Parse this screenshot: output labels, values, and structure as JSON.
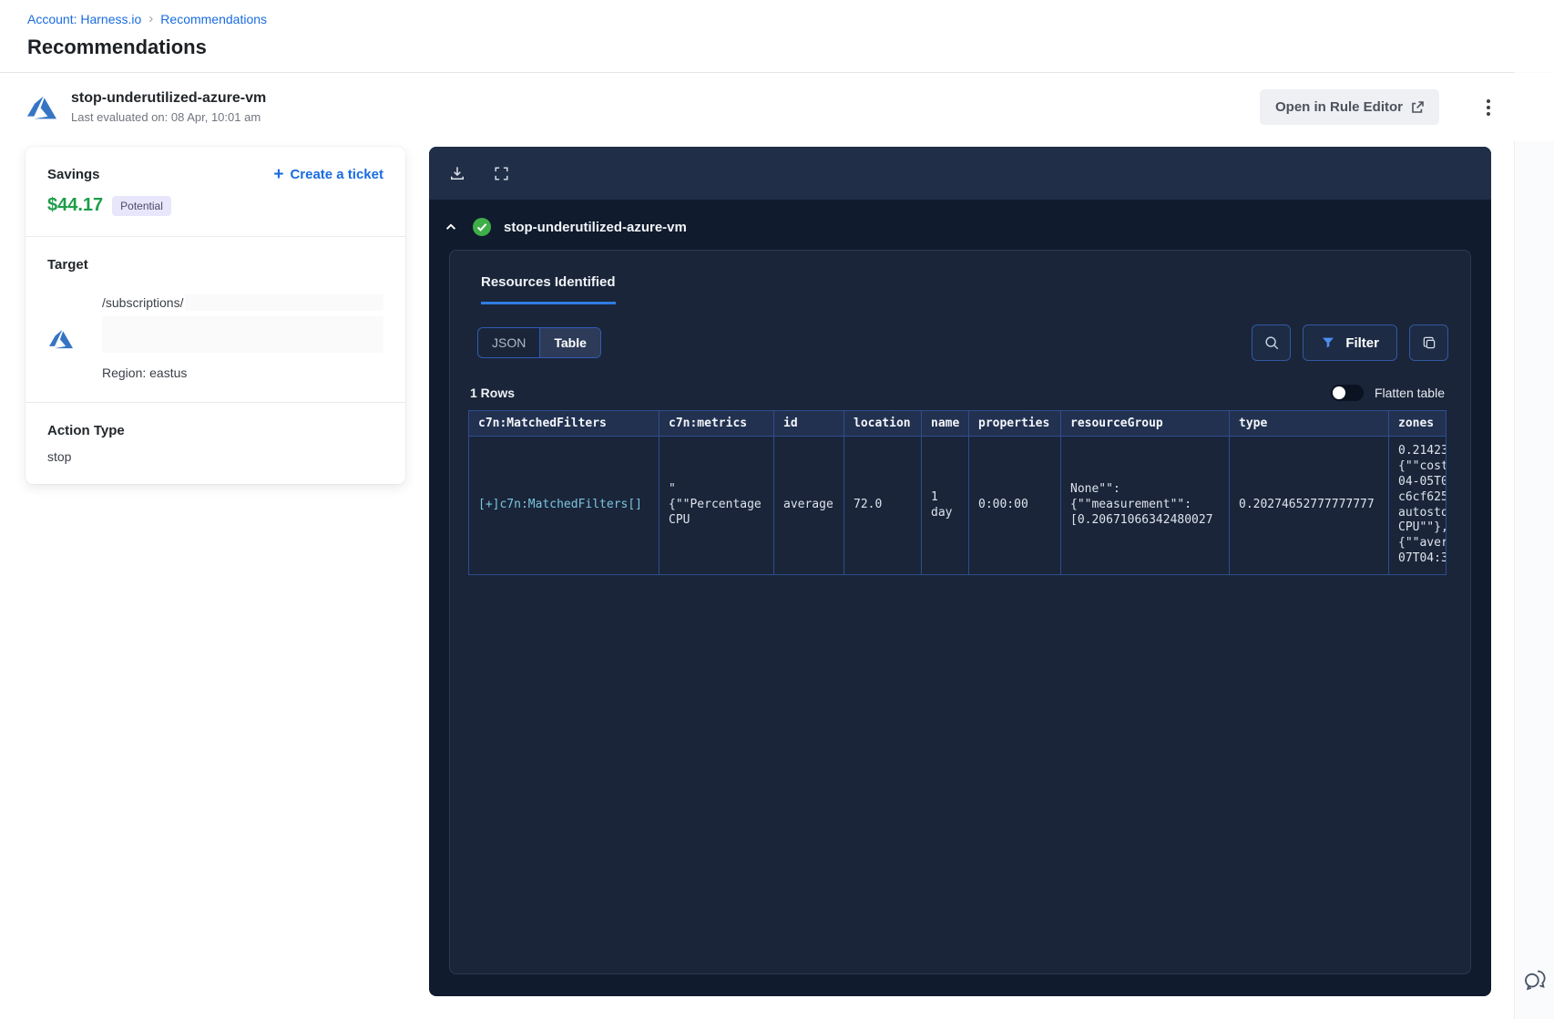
{
  "breadcrumb": {
    "account": "Account: Harness.io",
    "separator": "›",
    "current": "Recommendations"
  },
  "page_title": "Recommendations",
  "recommendation_header": {
    "name": "stop-underutilized-azure-vm",
    "last_evaluated": "Last evaluated on: 08 Apr, 10:01 am",
    "open_rule_editor_label": "Open in Rule Editor"
  },
  "savings_card": {
    "savings_label": "Savings",
    "create_ticket_label": "Create a ticket",
    "plus_glyph": "+",
    "amount": "$44.17",
    "badge": "Potential",
    "target_label": "Target",
    "target_path": "/subscriptions/",
    "region": "Region: eastus",
    "action_type_label": "Action Type",
    "action_type_value": "stop"
  },
  "panel": {
    "title": "stop-underutilized-azure-vm",
    "tab_label": "Resources Identified",
    "view_toggle": {
      "json_label": "JSON",
      "table_label": "Table",
      "selected": "Table"
    },
    "filter_label": "Filter",
    "rows_count": "1 Rows",
    "flatten_label": "Flatten table",
    "flatten_enabled": false,
    "table": {
      "columns": [
        "c7n:MatchedFilters",
        "c7n:metrics",
        "id",
        "location",
        "name",
        "properties",
        "resourceGroup",
        "type",
        "zones"
      ],
      "rows": [
        {
          "cells": [
            "[+]c7n:MatchedFilters[]",
            "\"\n{\"\"Percentage\nCPU",
            "average",
            "72.0",
            "1\nday",
            "0:00:00",
            "None\"\":\n{\"\"measurement\"\":\n[0.20671066342480027",
            "0.20274652777777777",
            "0.21423\n{\"\"cost\n04-05T0\nc6cf625\nautosto\nCPU\"\"},\n{\"\"aver\n07T04:3"
          ]
        }
      ]
    }
  },
  "colors": {
    "accent_blue": "#1a6ce0",
    "savings_green": "#1e9e4a",
    "badge_bg": "#e8e6fb",
    "panel_bg": "#101b2d",
    "toolbar_bg": "#202e48",
    "table_border": "#2e4d8f",
    "check_green": "#3fae49",
    "azure_blue": "#3575c4",
    "funnel_blue": "#4d8ef0",
    "tab_underline": "#2f7de1"
  }
}
